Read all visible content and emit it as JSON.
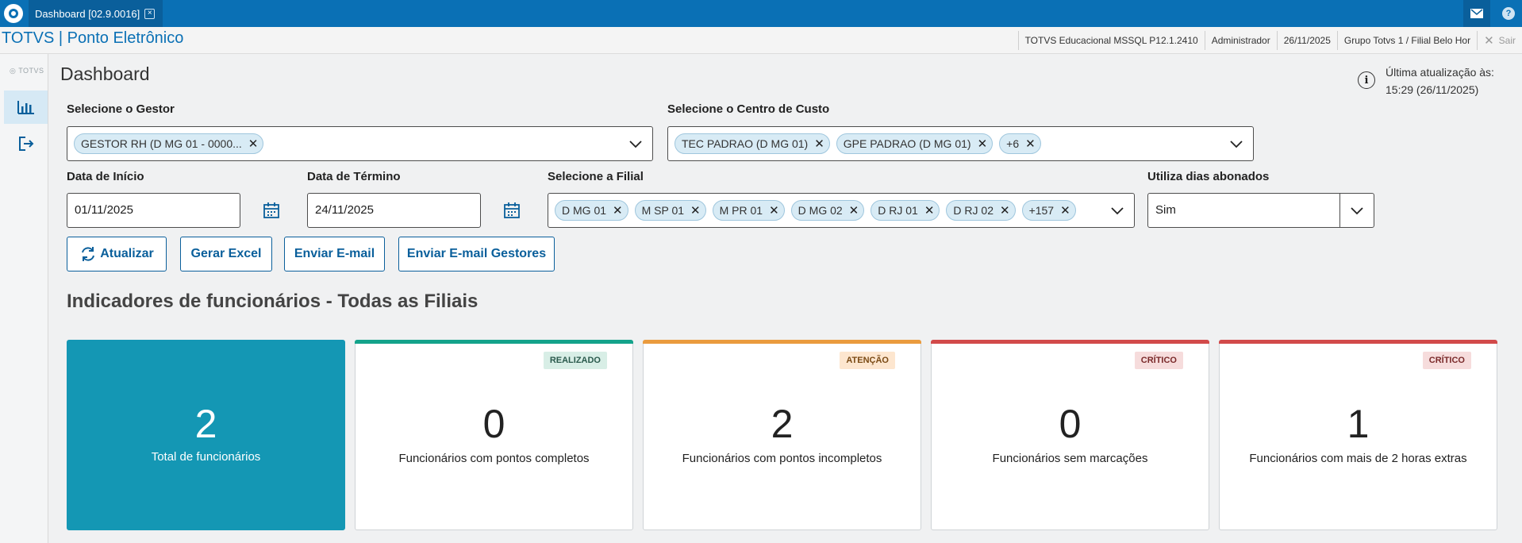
{
  "topbar": {
    "tab_label": "Dashboard [02.9.0016]",
    "tab_close": "×",
    "help": "?"
  },
  "infobar": {
    "app_title": "TOTVS | Ponto Eletrônico",
    "system": "TOTVS Educacional MSSQL P12.1.2410",
    "user": "Administrador",
    "date": "26/11/2025",
    "branch": "Grupo Totvs 1 / Filial Belo Hor",
    "exit": "Sair"
  },
  "sidebar": {
    "logo": "TOTVS",
    "items": [
      {
        "icon": "bar-chart-icon",
        "active": true
      },
      {
        "icon": "logout-icon",
        "active": false
      }
    ]
  },
  "page": {
    "title": "Dashboard",
    "update_label": "Última atualização às:",
    "update_value": "15:29 (26/11/2025)"
  },
  "filters": {
    "gestor": {
      "label": "Selecione o Gestor",
      "chips": [
        "GESTOR RH (D MG 01 - 0000..."
      ]
    },
    "centro_custo": {
      "label": "Selecione o Centro de Custo",
      "chips": [
        "TEC PADRAO (D MG 01)",
        "GPE PADRAO (D MG 01)",
        "+6"
      ]
    },
    "data_inicio": {
      "label": "Data de Início",
      "value": "01/11/2025"
    },
    "data_termino": {
      "label": "Data de Término",
      "value": "24/11/2025"
    },
    "filial": {
      "label": "Selecione a Filial",
      "chips": [
        "D MG 01",
        "M SP 01",
        "M PR 01",
        "D MG 02",
        "D RJ 01",
        "D RJ 02",
        "+157"
      ]
    },
    "dias_abonados": {
      "label": "Utiliza dias abonados",
      "value": "Sim"
    }
  },
  "actions": {
    "atualizar": "Atualizar",
    "gerar_excel": "Gerar Excel",
    "enviar_email": "Enviar E-mail",
    "enviar_email_gestores": "Enviar E-mail Gestores"
  },
  "section_title": "Indicadores de funcionários - Todas as Filiais",
  "cards": [
    {
      "value": "2",
      "label": "Total de funcionários",
      "badge": "",
      "bar_color": "",
      "badge_bg": "",
      "badge_fg": ""
    },
    {
      "value": "0",
      "label": "Funcionários com pontos completos",
      "badge": "REALIZADO",
      "bar_color": "#14a38b",
      "badge_bg": "#d8eee6",
      "badge_fg": "#2b5a4d"
    },
    {
      "value": "2",
      "label": "Funcionários com pontos incompletos",
      "badge": "ATENÇÃO",
      "bar_color": "#ea9b3e",
      "badge_bg": "#fde6cf",
      "badge_fg": "#7a4a14"
    },
    {
      "value": "0",
      "label": "Funcionários sem marcações",
      "badge": "CRÍTICO",
      "bar_color": "#d24a4a",
      "badge_bg": "#f6dcdc",
      "badge_fg": "#7a2a2a"
    },
    {
      "value": "1",
      "label": "Funcionários com mais de 2 horas extras",
      "badge": "CRÍTICO",
      "bar_color": "#d24a4a",
      "badge_bg": "#f6dcdc",
      "badge_fg": "#7a2a2a"
    }
  ]
}
